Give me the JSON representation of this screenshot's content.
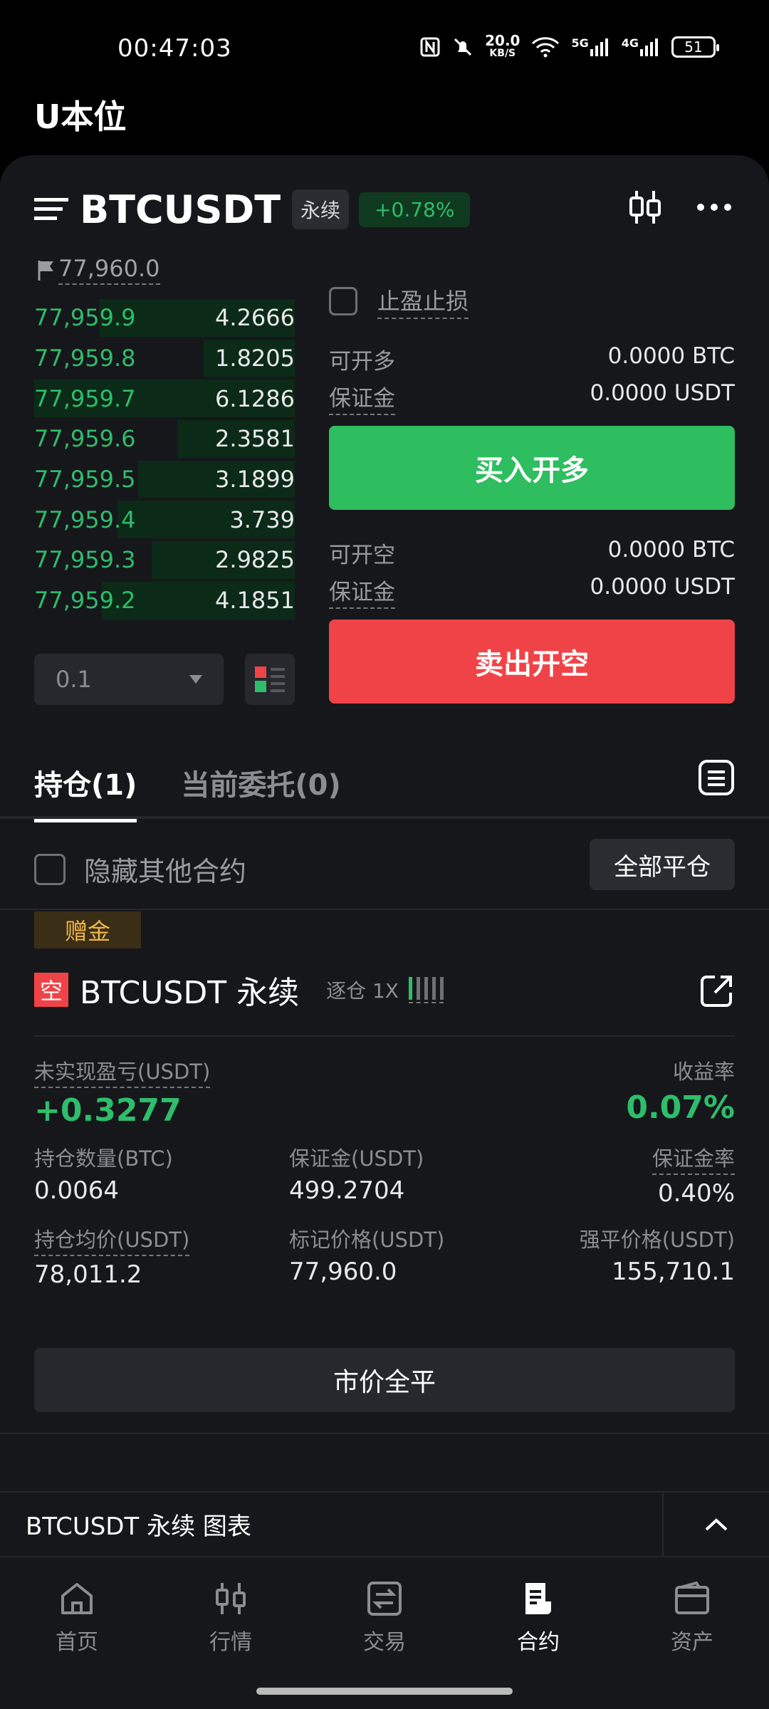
{
  "status": {
    "time": "00:47:03",
    "speed_value": "20.0",
    "speed_unit": "KB/S",
    "net1": "5G",
    "net2": "4G",
    "battery": "51"
  },
  "page_title": "U本位",
  "header": {
    "symbol": "BTCUSDT",
    "perp_tag": "永续",
    "change": "+0.78%"
  },
  "orderbook": {
    "mark_price": "77,960.0",
    "rows": [
      {
        "price": "77,959.9",
        "qty": "4.2666",
        "depth": 0.75
      },
      {
        "price": "77,959.8",
        "qty": "1.8205",
        "depth": 0.35
      },
      {
        "price": "77,959.7",
        "qty": "6.1286",
        "depth": 1.0
      },
      {
        "price": "77,959.6",
        "qty": "2.3581",
        "depth": 0.45
      },
      {
        "price": "77,959.5",
        "qty": "3.1899",
        "depth": 0.6
      },
      {
        "price": "77,959.4",
        "qty": "3.739",
        "depth": 0.68
      },
      {
        "price": "77,959.3",
        "qty": "2.9825",
        "depth": 0.55
      },
      {
        "price": "77,959.2",
        "qty": "4.1851",
        "depth": 0.74
      }
    ],
    "qty_select": "0.1"
  },
  "form": {
    "tpsl_label": "止盈止损",
    "long": {
      "avail_label": "可开多",
      "avail_value": "0.0000 BTC",
      "margin_label": "保证金",
      "margin_value": "0.0000 USDT",
      "button": "买入开多"
    },
    "short": {
      "avail_label": "可开空",
      "avail_value": "0.0000 BTC",
      "margin_label": "保证金",
      "margin_value": "0.0000 USDT",
      "button": "卖出开空"
    }
  },
  "tabs": [
    {
      "label": "持仓(1)"
    },
    {
      "label": "当前委托(0)"
    }
  ],
  "hide_others_label": "隐藏其他合约",
  "close_all_label": "全部平仓",
  "position": {
    "bonus_tag": "赠金",
    "side": "空",
    "symbol": "BTCUSDT 永续",
    "mode": "逐仓 1X",
    "pnl_label": "未实现盈亏(USDT)",
    "pnl_value": "+0.3277",
    "roe_label": "收益率",
    "roe_value": "0.07%",
    "size_label": "持仓数量(BTC)",
    "size_value": "0.0064",
    "margin_label": "保证金(USDT)",
    "margin_value": "499.2704",
    "margin_ratio_label": "保证金率",
    "margin_ratio_value": "0.40%",
    "entry_label": "持仓均价(USDT)",
    "entry_value": "78,011.2",
    "mark_label": "标记价格(USDT)",
    "mark_value": "77,960.0",
    "liq_label": "强平价格(USDT)",
    "liq_value": "155,710.1",
    "market_close": "市价全平"
  },
  "chart_bar_label": "BTCUSDT 永续 图表",
  "nav": [
    {
      "label": "首页",
      "icon": "home-icon"
    },
    {
      "label": "行情",
      "icon": "candles-icon"
    },
    {
      "label": "交易",
      "icon": "swap-icon"
    },
    {
      "label": "合约",
      "icon": "contract-icon"
    },
    {
      "label": "资产",
      "icon": "wallet-icon"
    }
  ],
  "colors": {
    "green": "#2ebd6b",
    "red": "#f04348",
    "bonus": "#f0b64a"
  }
}
